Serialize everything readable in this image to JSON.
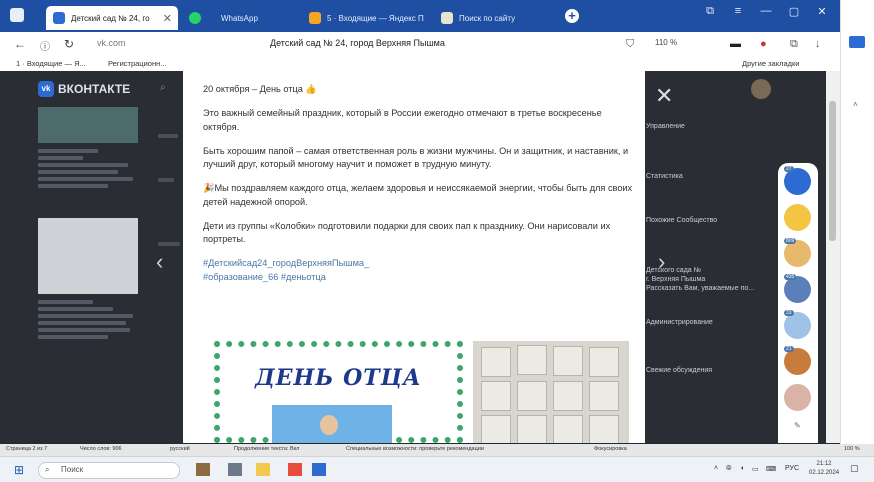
{
  "browser": {
    "tabs": [
      {
        "label": "Детский сад № 24, го",
        "active": true
      },
      {
        "label": "WhatsApp",
        "active": false
      },
      {
        "label": "5 · Входящие — Яндекс П",
        "active": false
      },
      {
        "label": "Поиск по сайту",
        "active": false
      }
    ],
    "window_controls": {
      "minimize": "—",
      "restore": "▢",
      "close": "✕"
    },
    "address": {
      "domain": "vk.com",
      "page_title": "Детский сад № 24, город Верхняя Пышма",
      "zoom": "110 %"
    },
    "bookmarks": [
      {
        "label": "1 · Входящие — Я..."
      },
      {
        "label": "Регистрационн..."
      }
    ],
    "other_bookmarks": "Другие закладки"
  },
  "vk": {
    "logo_text": "ВКОНТАКТЕ",
    "right_col_items": [
      "Управление",
      "Статистика",
      "Похожие Сообщество",
      "Детского сада №",
      "г. Верхняя Пышма",
      "Рассказать Вам, уважаемые по...",
      "Администрирование",
      "Свежие обсуждения"
    ]
  },
  "post": {
    "headline": "20 октября – День отца 👍",
    "paragraphs": [
      "Это важный семейный праздник, который в России ежегодно отмечают в третье воскресенье октября.",
      "Быть хорошим папой – самая ответственная роль в жизни мужчины. Он и защитник, и наставник, и лучший друг, который многому научит и поможет в трудную минуту.",
      "🎉Мы поздравляем каждого отца, желаем здоровья и неиссякаемой энергии, чтобы быть для своих детей надежной опорой.",
      "Дети из группы «Колобки» подготовили подарки для своих пап к празднику. Они нарисовали их портреты."
    ],
    "hashtags_line1": "#Детскийсад24_городВерхняяПышма_",
    "hashtags_line2": "#образование_66 #деньотца",
    "photo_title": "ДЕНЬ ОТЦА"
  },
  "chats": [
    {
      "badge": "27",
      "color": "#2d6ad1"
    },
    {
      "badge": "",
      "color": "#f4c542"
    },
    {
      "badge": "809",
      "color": "#e8b86d"
    },
    {
      "badge": "435",
      "color": "#5b7fb8"
    },
    {
      "badge": "33",
      "color": "#9fc3e6"
    },
    {
      "badge": "21",
      "color": "#c77b3c"
    },
    {
      "badge": "",
      "color": "#d9b2a8"
    }
  ],
  "statusbar": {
    "page": "Страница 2 из 7",
    "words": "Число слов: 906",
    "lang": "русский",
    "predict": "Продолжение текста: Вкл",
    "access": "Специальные возможности: проверьте рекомендации",
    "focus": "Фокусировка",
    "zoom": "100 %"
  },
  "taskbar": {
    "search_placeholder": "Поиск",
    "lang": "РУС",
    "time": "21:12",
    "date": "02.12.2024"
  }
}
